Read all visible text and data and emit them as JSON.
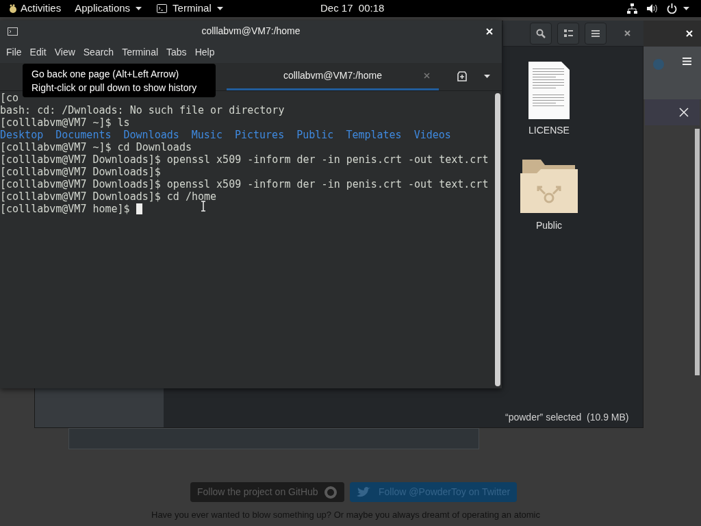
{
  "top_bar": {
    "activities": "Activities",
    "applications": "Applications",
    "app_menu": "Terminal",
    "clock": "Dec 17  00:18"
  },
  "terminal": {
    "title": "colllabvm@VM7:/home",
    "menu": [
      "File",
      "Edit",
      "View",
      "Search",
      "Terminal",
      "Tabs",
      "Help"
    ],
    "tabs": [
      {
        "label": "colllabvm@VM7:/home",
        "selected": true
      }
    ],
    "tooltip": [
      "Go back one page (Alt+Left Arrow)",
      "Right-click or pull down to show history"
    ],
    "lines": [
      {
        "kind": "text",
        "text": "[co"
      },
      {
        "kind": "text",
        "text": "bash: cd: /Dwnloads: No such file or directory"
      },
      {
        "kind": "text",
        "text": "[colllabvm@VM7 ~]$ ls"
      },
      {
        "kind": "dirs",
        "items": [
          "Desktop",
          "Documents",
          "Downloads",
          "Music",
          "Pictures",
          "Public",
          "Templates",
          "Videos"
        ]
      },
      {
        "kind": "text",
        "text": "[colllabvm@VM7 ~]$ cd Downloads"
      },
      {
        "kind": "text",
        "text": "[colllabvm@VM7 Downloads]$ openssl x509 -inform der -in penis.crt -out text.crt"
      },
      {
        "kind": "text",
        "text": "[colllabvm@VM7 Downloads]$"
      },
      {
        "kind": "text",
        "text": "[colllabvm@VM7 Downloads]$ openssl x509 -inform der -in penis.crt -out text.crt"
      },
      {
        "kind": "text",
        "text": "[colllabvm@VM7 Downloads]$ cd /home"
      },
      {
        "kind": "cursor",
        "text": "[colllabvm@VM7 home]$"
      }
    ]
  },
  "file_manager": {
    "items": [
      {
        "name": "LICENSE",
        "kind": "document"
      },
      {
        "name": "Public",
        "kind": "folder"
      }
    ],
    "status": "“powder” selected  (10.9 MB)"
  },
  "web_page": {
    "github_button": "Follow the project on GitHub",
    "twitter_button": "Follow @PowderToy on Twitter",
    "paragraph": "Have you ever wanted to blow something up? Or maybe you always dreamt of operating an atomic"
  }
}
